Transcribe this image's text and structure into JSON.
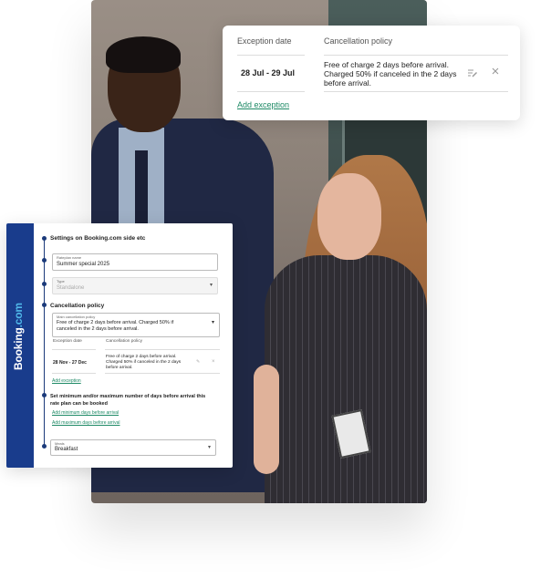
{
  "top_card": {
    "col_exception_date": "Exception date",
    "col_cancellation_policy": "Cancellation policy",
    "row": {
      "dates": "28 Jul  - 29 Jul",
      "policy": "Free of charge 2 days before arrival. Charged 50% if canceled in the 2 days before arrival."
    },
    "add_exception": "Add exception"
  },
  "settings_card": {
    "brand": {
      "name": "Booking",
      "suffix": ".com"
    },
    "section_title": "Settings on Booking.com side etc",
    "rateplan": {
      "label": "Rateplan name",
      "value": "Summer special 2025"
    },
    "type": {
      "label": "Type",
      "value": "Standalone"
    },
    "cancellation_title": "Cancellation policy",
    "main_policy": {
      "label": "Main cancellation policy",
      "value": "Free of charge 2 days before arrival. Charged 50% if canceled in the 2 days before arrival."
    },
    "exceptions": {
      "col_exception_date": "Exception date",
      "col_cancellation_policy": "Cancellation policy",
      "row": {
        "dates": "28 Nov  - 27 Dec",
        "policy": "Free of charge 2 days before arrival. Charged 50% if canceled in the 2 days before arrival."
      },
      "add_exception": "Add exception"
    },
    "min_max_title": "Set minimum and/or maximum number of days before arrival this rate plan can be booked",
    "add_min": "Add minimum days before arrival",
    "add_max": "Add maximum days before arrival",
    "meals": {
      "label": "Meals",
      "value": "Breakfast"
    }
  },
  "colors": {
    "brand_blue": "#193c8c",
    "link_green": "#1e8a66",
    "timeline": "#1b3a7a"
  }
}
